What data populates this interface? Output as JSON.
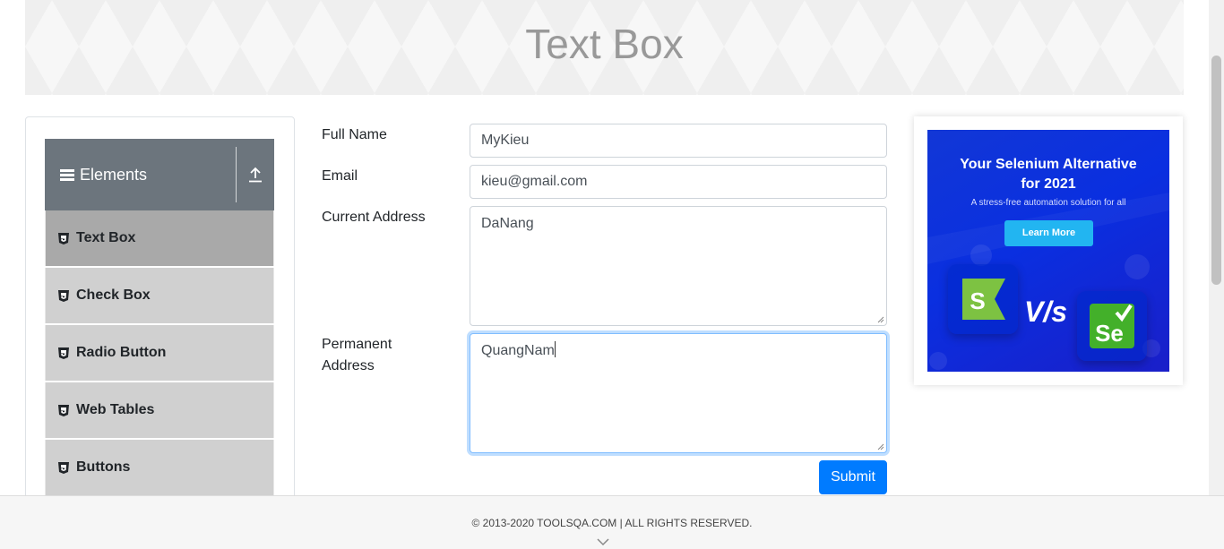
{
  "page": {
    "title": "Text Box"
  },
  "sidebar": {
    "group_title": "Elements",
    "items": [
      {
        "label": "Text Box",
        "active": true
      },
      {
        "label": "Check Box"
      },
      {
        "label": "Radio Button"
      },
      {
        "label": "Web Tables"
      },
      {
        "label": "Buttons"
      }
    ]
  },
  "form": {
    "full_name": {
      "label": "Full Name",
      "value": "MyKieu"
    },
    "email": {
      "label": "Email",
      "value": "kieu@gmail.com"
    },
    "current_address": {
      "label": "Current Address",
      "value": "DaNang"
    },
    "permanent_address": {
      "label_line1": "Permanent",
      "label_line2": "Address",
      "value": "QuangNam"
    },
    "submit_label": "Submit"
  },
  "ad": {
    "headline_line1": "Your Selenium Alternative",
    "headline_line2": "for 2021",
    "subtitle": "A stress-free automation solution for all",
    "cta": "Learn More",
    "vs": "V/s",
    "left_logo": "S",
    "right_logo": "Se"
  },
  "footer": {
    "copyright": "© 2013-2020 TOOLSQA.COM | ALL RIGHTS RESERVED."
  },
  "colors": {
    "accent": "#007bff",
    "sidebar_header": "#6c757d",
    "menu_item": "#d0d0d0",
    "menu_active": "#a9a9a9"
  }
}
